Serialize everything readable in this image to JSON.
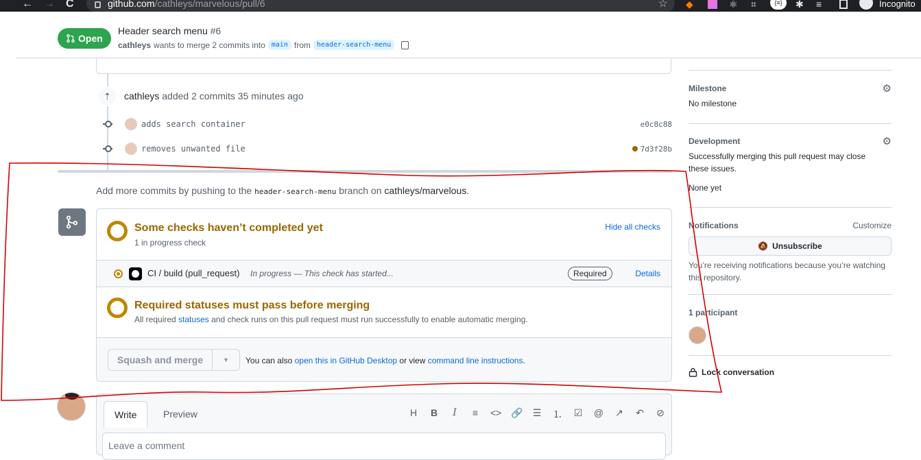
{
  "browser": {
    "url_host": "github.com",
    "url_path": "/cathleys/marvelous/pull/6",
    "incognito_label": "Incognito",
    "back_icon": "←",
    "forward_icon": "→",
    "reload_icon": "C",
    "star_icon": "☆",
    "ext_badge": "{≡}"
  },
  "pr": {
    "state": "Open",
    "title": "Header search menu",
    "number": "#6",
    "author": "cathleys",
    "merge_text": "wants to merge 2 commits into",
    "base": "main",
    "from_text": "from",
    "head": "header-search-menu"
  },
  "timeline": {
    "pushed_user": "cathleys",
    "pushed_text": "added 2 commits 35 minutes ago",
    "commits": [
      {
        "message": "adds search container",
        "sha": "e0c8c88"
      },
      {
        "message": "removes unwanted file",
        "sha": "7d3f28b"
      }
    ],
    "more_prefix": "Add more commits by pushing to the",
    "more_branch": "header-search-menu",
    "more_mid": "branch on",
    "more_repo": "cathleys/marvelous",
    "more_suffix": "."
  },
  "merge": {
    "checks_title": "Some checks haven’t completed yet",
    "checks_sub": "1 in progress check",
    "hide_all": "Hide all checks",
    "check_name": "CI / build (pull_request)",
    "check_status": "In progress — This check has started...",
    "required": "Required",
    "details": "Details",
    "req_title": "Required statuses must pass before merging",
    "req_sub_pre": "All required",
    "req_sub_link": "statuses",
    "req_sub_post": "and check runs on this pull request must run successfully to enable automatic merging.",
    "squash_label": "Squash and merge",
    "also_pre": "You can also",
    "also_link1": "open this in GitHub Desktop",
    "also_mid": "or view",
    "also_link2": "command line instructions",
    "also_post": "."
  },
  "comment": {
    "tab_write": "Write",
    "tab_preview": "Preview",
    "tools": [
      "H",
      "B",
      "I",
      "≡",
      "<>",
      "🔗",
      "☰",
      "⒈",
      "☑",
      "@",
      "↗",
      "↶",
      "⊘"
    ],
    "placeholder": "Leave a comment"
  },
  "sidebar": {
    "milestone_label": "Milestone",
    "milestone_value": "No milestone",
    "development_label": "Development",
    "development_text": "Successfully merging this pull request may close these issues.",
    "development_value": "None yet",
    "notifications_label": "Notifications",
    "customize": "Customize",
    "unsubscribe": "Unsubscribe",
    "notif_reason": "You’re receiving notifications because you’re watching this repository.",
    "participants": "1 participant",
    "lock": "Lock conversation"
  },
  "colors": {
    "open_green": "#2da44e",
    "pending_yellow": "#bf8700",
    "link_blue": "#0969da",
    "annotation_red": "#d40000"
  }
}
